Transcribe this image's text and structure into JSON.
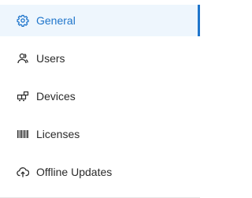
{
  "colors": {
    "accent": "#1f75cb",
    "active_bg": "#eef6fd",
    "text": "#2b2b2b"
  },
  "sidebar": {
    "items": [
      {
        "label": "General",
        "icon": "gear-icon",
        "active": true
      },
      {
        "label": "Users",
        "icon": "users-icon",
        "active": false
      },
      {
        "label": "Devices",
        "icon": "devices-icon",
        "active": false
      },
      {
        "label": "Licenses",
        "icon": "barcode-icon",
        "active": false
      },
      {
        "label": "Offline Updates",
        "icon": "cloud-upload-icon",
        "active": false
      }
    ]
  }
}
